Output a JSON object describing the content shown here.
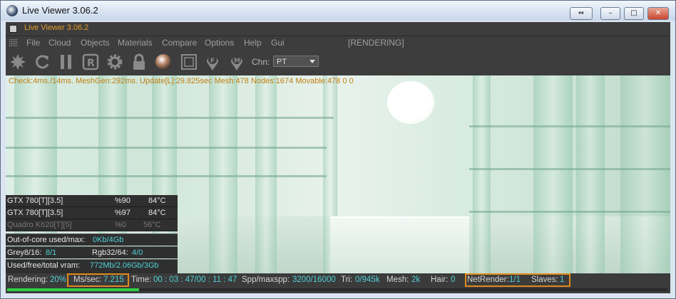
{
  "window": {
    "title": "Live Viewer 3.06.2",
    "btn_swap": "⇔",
    "btn_min": "–",
    "btn_max": "□",
    "btn_close": "✕"
  },
  "subtitle": "Live Viewer 3.06.2",
  "menu": {
    "items": [
      "File",
      "Cloud",
      "Objects",
      "Materials",
      "Compare",
      "Options",
      "Help",
      "Gui"
    ],
    "status": "[RENDERING]"
  },
  "toolbar": {
    "icons": [
      "aperture-icon",
      "refresh-icon",
      "pause-icon",
      "render-region-icon",
      "settings-gear-icon",
      "lock-icon",
      "material-sphere-icon",
      "frame-icon",
      "f-pin-icon",
      "m-pin-icon"
    ],
    "channel_label": "Chn:",
    "channel_value": "PT"
  },
  "stats_line": "Check:4ms./14ms. MeshGen:292ms. Update[L]:29.825sec Mesh:478 Nodes:1674 Movable:478  0 0",
  "gpus": [
    {
      "name": "GTX 780[T][3.5]",
      "usage": "%90",
      "temp": "84°C",
      "active": true
    },
    {
      "name": "GTX 780[T][3.5]",
      "usage": "%97",
      "temp": "84°C",
      "active": true
    },
    {
      "name": "Quadro K620[T][5]",
      "usage": "%0",
      "temp": "56°C",
      "active": false
    }
  ],
  "out_of_core": {
    "label": "Out-of-core used/max:",
    "value": "0Kb/4Gb"
  },
  "textures": {
    "grey_label": "Grey8/16:",
    "grey_value": "8/1",
    "rgb_label": "Rgb32/64:",
    "rgb_value": "4/0"
  },
  "vram": {
    "label": "Used/free/total vram:",
    "value": "772Mb/2.06Gb/3Gb"
  },
  "status": {
    "rendering_label": "Rendering:",
    "rendering_value": "20%",
    "ms_label": "Ms/sec:",
    "ms_value": "7.215",
    "time_label": "Time:",
    "time_value": "00 : 03 : 47/00 : 11 : 47",
    "spp_label": "Spp/maxspp:",
    "spp_value": "3200/16000",
    "tri_label": "Tri:",
    "tri_value": "0/945k",
    "mesh_label": "Mesh:",
    "mesh_value": "2k",
    "hair_label": "Hair:",
    "hair_value": "0",
    "netrender_label": "NetRender:",
    "netrender_value": "1/1",
    "slaves_label": "Slaves:",
    "slaves_value": "1"
  },
  "progress_fraction": 0.2,
  "colors": {
    "accent_orange": "#e08a1c",
    "value_cyan": "#4fd0d6",
    "progress_green": "#2fcf45"
  }
}
